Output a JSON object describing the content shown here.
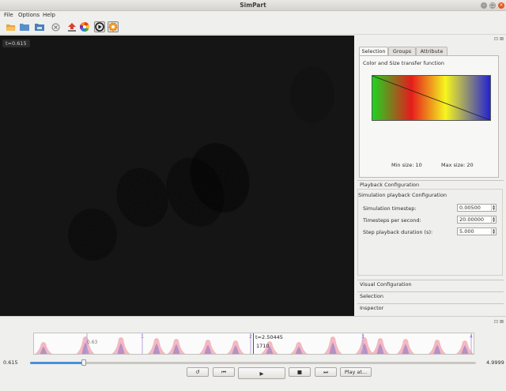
{
  "window": {
    "title": "SimPart"
  },
  "menu": {
    "file": "File",
    "options": "Options",
    "help": "Help"
  },
  "toolbar": {
    "icons": [
      "open-folder-icon",
      "folder-icon",
      "save-icon",
      "close-icon",
      "upload-icon",
      "color-wheel-icon",
      "play-circle-icon",
      "settings-icon"
    ]
  },
  "viewport": {
    "time_label": "t=0.615"
  },
  "panel": {
    "tabs": [
      "Selection",
      "Groups",
      "Attribute"
    ],
    "tf_title": "Color and Size transfer function",
    "min_size": "Min size: 10",
    "max_size": "Max size: 20",
    "playback_header": "Playback Configuration",
    "sim_playback": "Simulation playback Configuration",
    "fields": [
      {
        "label": "Simulation timestep:",
        "value": "0.00500"
      },
      {
        "label": "Timesteps per second:",
        "value": "20.00000"
      },
      {
        "label": "Step playback duration (s):",
        "value": "5.000"
      }
    ],
    "visual_header": "Visual Configuration",
    "selection_header": "Selection",
    "inspector_header": "Inspector"
  },
  "timeline": {
    "cursor_label": "t=2.50445",
    "cursor_count": "1710",
    "marker_label_start": "0.63",
    "marker_labels": [
      "1",
      "2",
      "3",
      "4"
    ],
    "range_min": "0.615",
    "range_max": "4.9999",
    "progress": 0.12
  },
  "controls": {
    "restart": "↺",
    "prev": "⏮",
    "play": "▶",
    "stop": "■",
    "next": "⏭",
    "play_at": "Play at..."
  },
  "colors": {
    "accent": "#4a90d9",
    "close_button": "#e95420",
    "viewport_bg": "#151515"
  }
}
